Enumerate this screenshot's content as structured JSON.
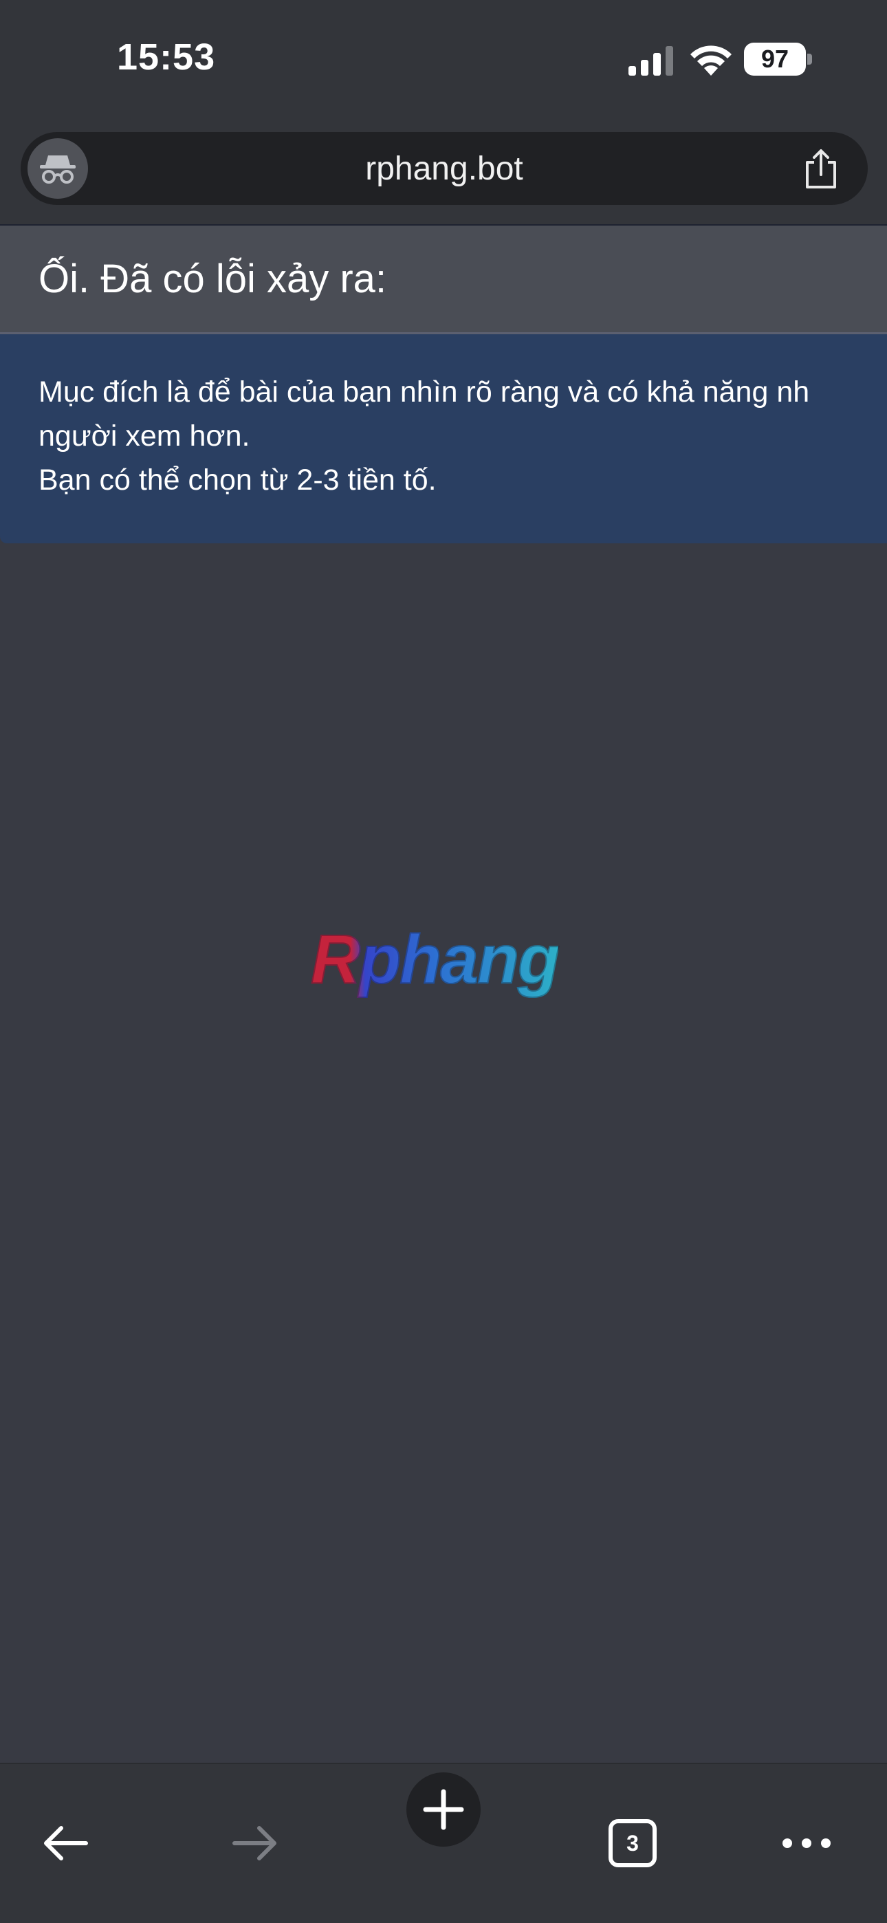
{
  "status_bar": {
    "time": "15:53",
    "battery": "97"
  },
  "address_bar": {
    "url": "rphang.bot",
    "left_icon": "incognito-icon",
    "right_icon": "share-icon"
  },
  "alert": {
    "title": "Ối. Đã có lỗi xảy ra:",
    "lines": [
      "Mục đích là để bài của bạn nhìn rõ ràng và có khả năng nh",
      "người xem hơn.",
      "Bạn có thể chọn từ 2-3 tiền tố."
    ]
  },
  "logo": {
    "text": "Rphang"
  },
  "bottom_toolbar": {
    "tab_count": "3",
    "icons": [
      "back-arrow-icon",
      "forward-arrow-icon",
      "plus-icon",
      "tabs-icon",
      "more-icon"
    ]
  },
  "colors": {
    "background": "#383a43",
    "chrome": "#33353a",
    "alert_header": "#4a4d55",
    "alert_body": "#2a3f62"
  }
}
